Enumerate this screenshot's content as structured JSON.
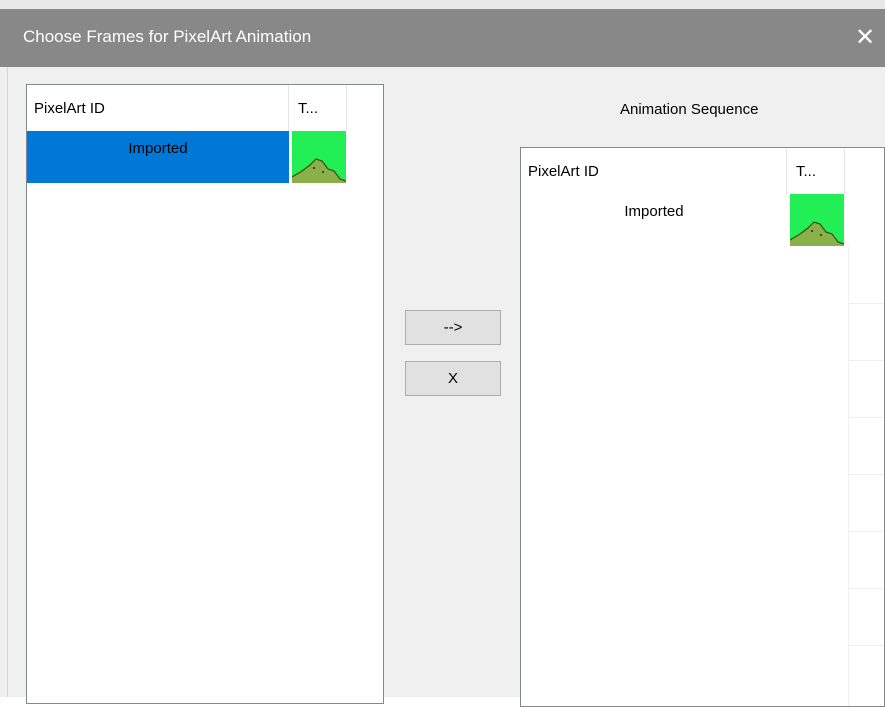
{
  "window": {
    "title": "Choose Frames for PixelArt Animation",
    "close_glyph": "✕"
  },
  "source_list": {
    "columns": [
      "PixelArt ID",
      "T..."
    ],
    "rows": [
      {
        "id": "Imported",
        "selected": true,
        "thumbnail_icon": "mountain-thumbnail-icon"
      }
    ]
  },
  "sequence": {
    "label": "Animation Sequence",
    "columns": [
      "PixelArt ID",
      "T..."
    ],
    "rows": [
      {
        "id": "Imported",
        "selected": false,
        "thumbnail_icon": "mountain-thumbnail-icon"
      }
    ]
  },
  "buttons": {
    "add_label": "-->",
    "remove_label": "X"
  },
  "colors": {
    "titlebar": "#888888",
    "selection": "#0078d7",
    "thumbnail_bg": "#22ee55",
    "mountain": "#8ab04a"
  }
}
